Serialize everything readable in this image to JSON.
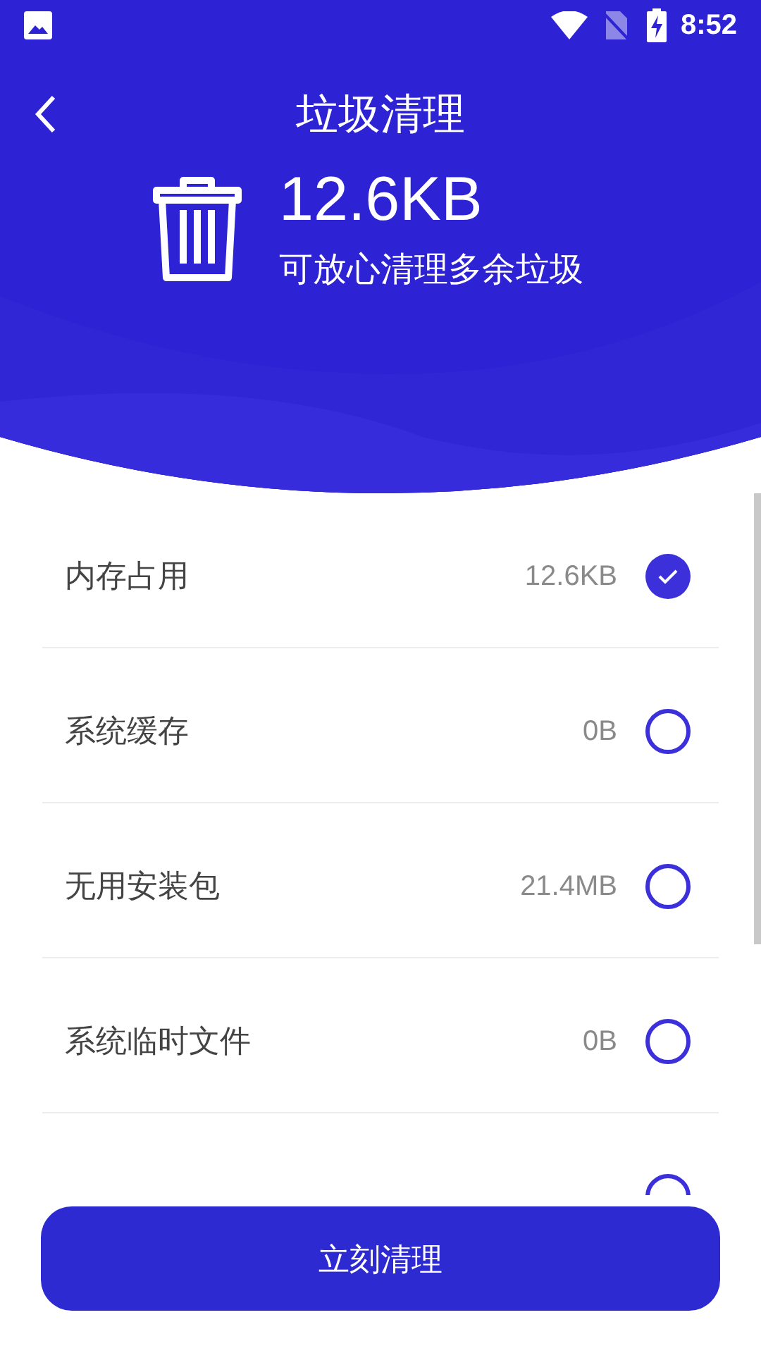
{
  "status_bar": {
    "time": "8:52"
  },
  "header": {
    "title": "垃圾清理",
    "size": "12.6KB",
    "subtitle": "可放心清理多余垃圾"
  },
  "items": [
    {
      "label": "内存占用",
      "size": "12.6KB",
      "checked": true
    },
    {
      "label": "系统缓存",
      "size": "0B",
      "checked": false
    },
    {
      "label": "无用安装包",
      "size": "21.4MB",
      "checked": false
    },
    {
      "label": "系统临时文件",
      "size": "0B",
      "checked": false
    },
    {
      "checked": false
    }
  ],
  "button": {
    "label": "立刻清理"
  }
}
